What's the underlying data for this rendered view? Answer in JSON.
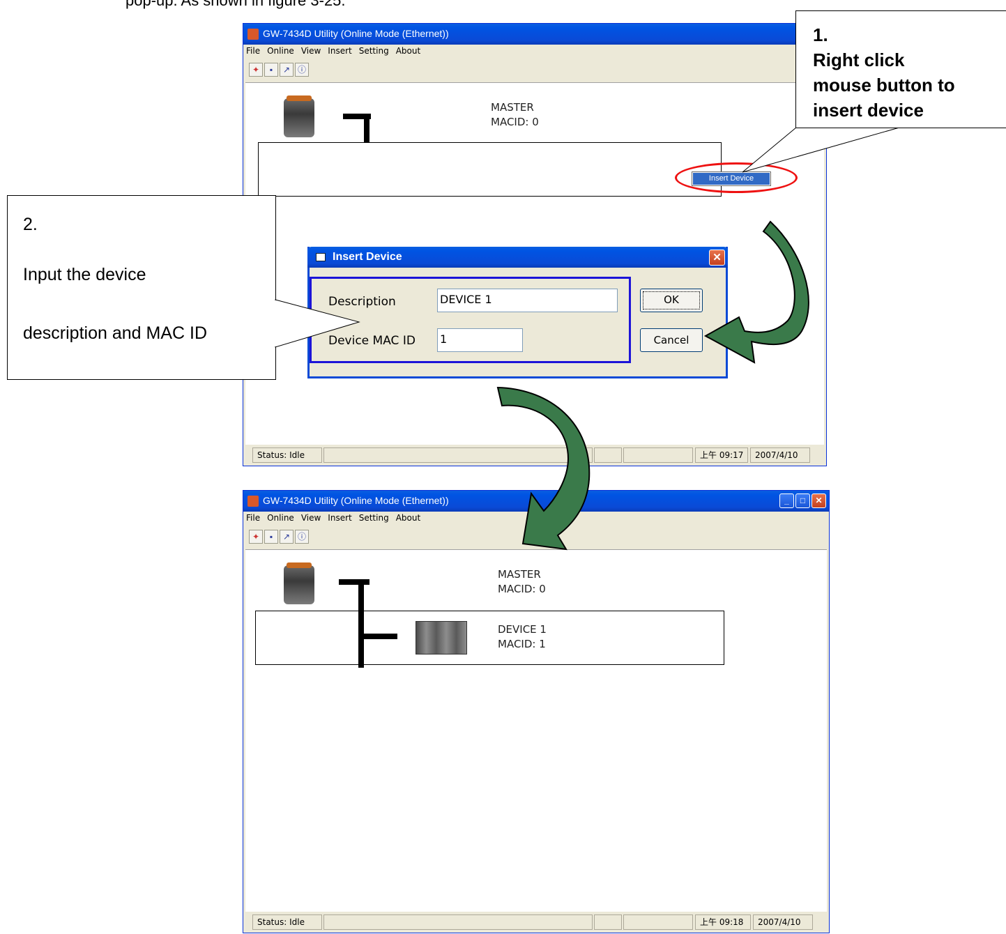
{
  "intro_text": "pop-up. As shown in figure 3-25.",
  "window1": {
    "title": "GW-7434D Utility (Online Mode (Ethernet))",
    "menu": [
      "File",
      "Online",
      "View",
      "Insert",
      "Setting",
      "About"
    ],
    "master_name": "MASTER",
    "master_macid": "MACID:  0",
    "context_menu_item": "Insert Device",
    "status": "Status: Idle",
    "time": "上午 09:17",
    "date": "2007/4/10"
  },
  "window2": {
    "title": "GW-7434D Utility (Online Mode (Ethernet))",
    "menu": [
      "File",
      "Online",
      "View",
      "Insert",
      "Setting",
      "About"
    ],
    "master_name": "MASTER",
    "master_macid": "MACID:  0",
    "device_name": "DEVICE 1",
    "device_macid": "MACID:  1",
    "status": "Status: Idle",
    "time": "上午 09:18",
    "date": "2007/4/10"
  },
  "dialog": {
    "title": "Insert Device",
    "description_label": "Description",
    "description_value": "DEVICE 1",
    "macid_label": "Device MAC ID",
    "macid_value": "1",
    "ok_label": "OK",
    "cancel_label": "Cancel"
  },
  "callout1": {
    "line1": "1.",
    "line2": "Right click",
    "line3": "mouse button to",
    "line4": "insert device"
  },
  "callout2": {
    "line1": "2.",
    "line2": "Input the device",
    "line3": "description and MAC ID"
  },
  "colors": {
    "arrow": "#3a7a4a",
    "highlight": "#e11111",
    "dialog_frame": "#1c14d8"
  }
}
